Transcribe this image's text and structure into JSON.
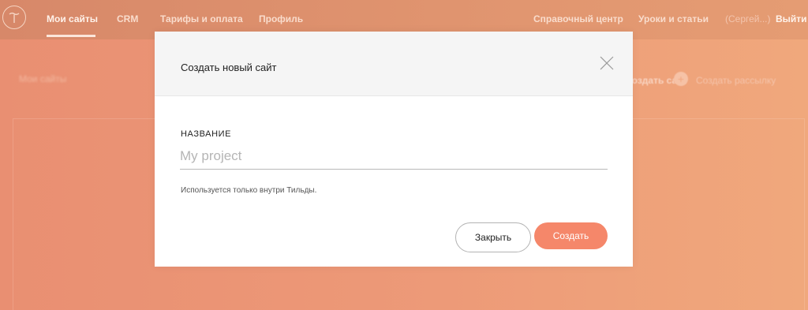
{
  "nav": {
    "items": [
      "Мои сайты",
      "CRM",
      "Тарифы и оплата",
      "Профиль"
    ],
    "help": "Справочный центр",
    "lessons": "Уроки и статьи",
    "user": "(Сергей...)",
    "logout": "Выйти"
  },
  "background": {
    "left_text": "Мои сайты",
    "right_text_1": "Создать сайт",
    "right_text_2": "Создать рассылку"
  },
  "modal": {
    "title": "Создать новый сайт",
    "field_label": "НАЗВАНИЕ",
    "name_placeholder": "My project",
    "name_value": "",
    "hint": "Используется только внутри Тильды.",
    "close_label": "Закрыть",
    "create_label": "Создать"
  },
  "colors": {
    "accent": "#f5876a",
    "overlay": "#e98f72",
    "header_bg": "#f5f5f5"
  },
  "icons": {
    "logo": "tilda-logo",
    "close": "close-icon",
    "plus": "plus-icon"
  }
}
